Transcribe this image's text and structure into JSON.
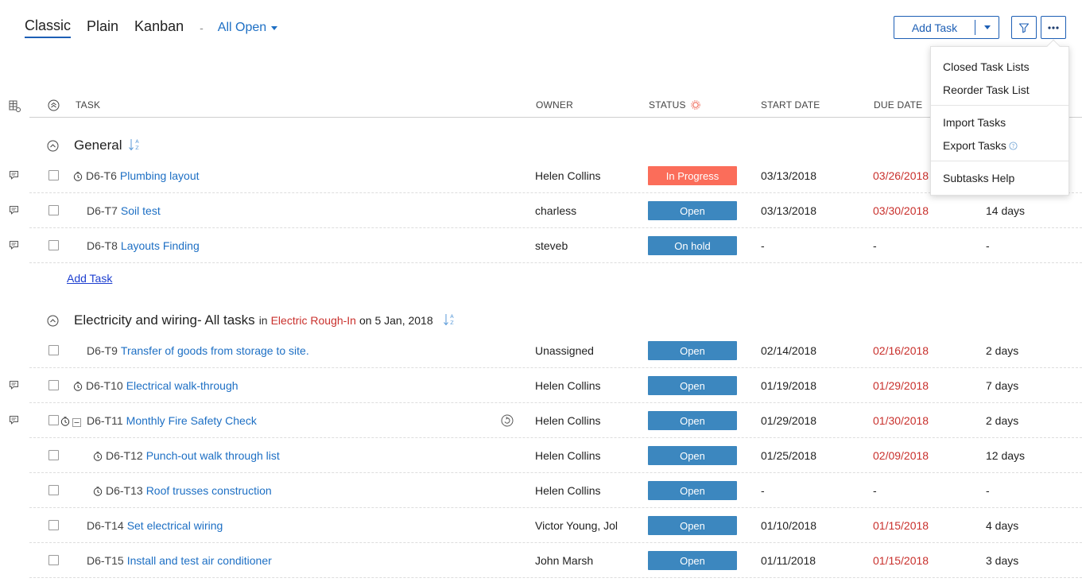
{
  "view_tabs": [
    {
      "label": "Classic",
      "active": true
    },
    {
      "label": "Plain",
      "active": false
    },
    {
      "label": "Kanban",
      "active": false
    }
  ],
  "view_separator": "-",
  "view_filter": "All Open",
  "toolbar": {
    "add_task_label": "Add Task"
  },
  "menu": {
    "items": [
      "Closed Task Lists",
      "Reorder Task List",
      "Import Tasks",
      "Export Tasks",
      "Subtasks Help"
    ]
  },
  "columns": {
    "task": "TASK",
    "owner": "OWNER",
    "status": "STATUS",
    "start_date": "START DATE",
    "due_date": "DUE DATE"
  },
  "colors": {
    "accent": "#1d6fc4",
    "in_progress": "#fb6d5a",
    "open": "#3c87bf",
    "on_hold": "#3c87bf",
    "overdue": "#c9302c"
  },
  "groups": [
    {
      "title": "General",
      "add_task": "Add Task",
      "tasks": [
        {
          "id": "D6-T6",
          "name": "Plumbing layout",
          "owner": "Helen Collins",
          "status": "In Progress",
          "start": "03/13/2018",
          "due": "03/26/2018",
          "duration": "",
          "clock": true,
          "comment": true,
          "indent": 0
        },
        {
          "id": "D6-T7",
          "name": "Soil test",
          "owner": "charless",
          "status": "Open",
          "start": "03/13/2018",
          "due": "03/30/2018",
          "duration": "14 days",
          "clock": false,
          "comment": true,
          "indent": 0
        },
        {
          "id": "D6-T8",
          "name": "Layouts Finding",
          "owner": "steveb",
          "status": "On hold",
          "start": "-",
          "due": "-",
          "duration": "-",
          "clock": false,
          "comment": true,
          "indent": 0
        }
      ]
    },
    {
      "title": "Electricity and wiring- All tasks",
      "in_label": "in",
      "milestone": "Electric Rough-In",
      "on_label": "on 5 Jan, 2018",
      "tasks": [
        {
          "id": "D6-T9",
          "name": "Transfer of goods from storage to site.",
          "owner": "Unassigned",
          "status": "Open",
          "start": "02/14/2018",
          "due": "02/16/2018",
          "duration": "2 days",
          "clock": false,
          "comment": false,
          "indent": 0
        },
        {
          "id": "D6-T10",
          "name": "Electrical walk-through",
          "owner": "Helen Collins",
          "status": "Open",
          "start": "01/19/2018",
          "due": "01/29/2018",
          "duration": "7 days",
          "clock": true,
          "comment": true,
          "indent": 0
        },
        {
          "id": "D6-T11",
          "name": "Monthly Fire Safety Check",
          "owner": "Helen Collins",
          "status": "Open",
          "start": "01/29/2018",
          "due": "01/30/2018",
          "duration": "2 days",
          "clock": true,
          "comment": true,
          "indent": 0,
          "parent": true,
          "recurring": true
        },
        {
          "id": "D6-T12",
          "name": "Punch-out walk through list",
          "owner": "Helen Collins",
          "status": "Open",
          "start": "01/25/2018",
          "due": "02/09/2018",
          "duration": "12 days",
          "clock": true,
          "comment": false,
          "indent": 1
        },
        {
          "id": "D6-T13",
          "name": "Roof trusses construction",
          "owner": "Helen Collins",
          "status": "Open",
          "start": "-",
          "due": "-",
          "duration": "-",
          "clock": true,
          "comment": false,
          "indent": 1
        },
        {
          "id": "D6-T14",
          "name": "Set electrical wiring",
          "owner": "Victor Young, Jol",
          "status": "Open",
          "start": "01/10/2018",
          "due": "01/15/2018",
          "duration": "4 days",
          "clock": false,
          "comment": false,
          "indent": 0
        },
        {
          "id": "D6-T15",
          "name": "Install and test air conditioner",
          "owner": "John Marsh",
          "status": "Open",
          "start": "01/11/2018",
          "due": "01/15/2018",
          "duration": "3 days",
          "clock": false,
          "comment": false,
          "indent": 0
        }
      ]
    }
  ]
}
